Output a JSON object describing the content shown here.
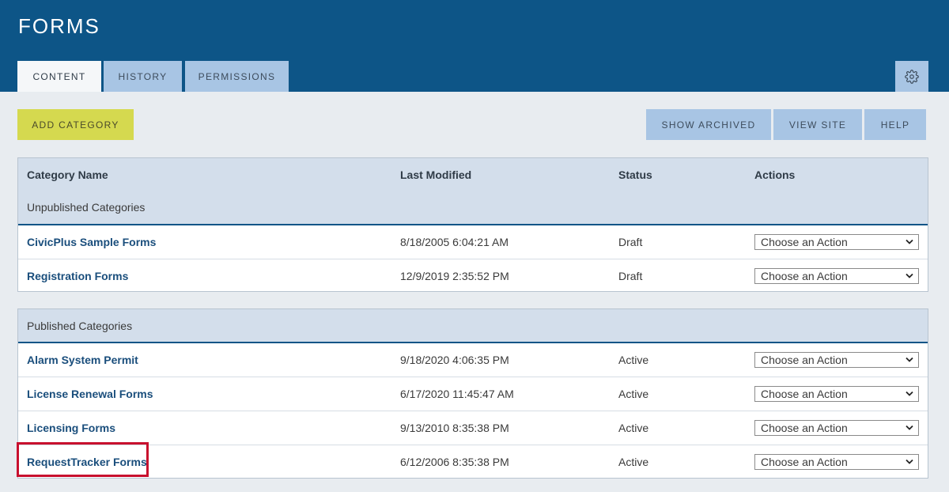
{
  "header": {
    "title": "FORMS"
  },
  "tabs": [
    {
      "label": "CONTENT",
      "active": true
    },
    {
      "label": "HISTORY",
      "active": false
    },
    {
      "label": "PERMISSIONS",
      "active": false
    }
  ],
  "settings": {
    "icon": "gear-icon"
  },
  "toolbar": {
    "add_category": "ADD CATEGORY",
    "show_archived": "SHOW ARCHIVED",
    "view_site": "VIEW SITE",
    "help": "HELP"
  },
  "columns": {
    "name": "Category Name",
    "modified": "Last Modified",
    "status": "Status",
    "actions": "Actions"
  },
  "unpublished": {
    "label": "Unpublished Categories",
    "rows": [
      {
        "name": "CivicPlus Sample Forms",
        "modified": "8/18/2005 6:04:21 AM",
        "status": "Draft",
        "action": "Choose an Action"
      },
      {
        "name": "Registration Forms",
        "modified": "12/9/2019 2:35:52 PM",
        "status": "Draft",
        "action": "Choose an Action"
      }
    ]
  },
  "published": {
    "label": "Published Categories",
    "rows": [
      {
        "name": "Alarm System Permit",
        "modified": "9/18/2020 4:06:35 PM",
        "status": "Active",
        "action": "Choose an Action"
      },
      {
        "name": "License Renewal Forms",
        "modified": "6/17/2020 11:45:47 AM",
        "status": "Active",
        "action": "Choose an Action"
      },
      {
        "name": "Licensing Forms",
        "modified": "9/13/2010 8:35:38 PM",
        "status": "Active",
        "action": "Choose an Action"
      },
      {
        "name": "RequestTracker Forms",
        "modified": "6/12/2006 8:35:38 PM",
        "status": "Active",
        "action": "Choose an Action"
      }
    ]
  },
  "colors": {
    "header": "#0d5587",
    "tab": "#a8c5e4",
    "add_button": "#d5d94f",
    "link": "#1a4e7c",
    "highlight": "#c8102e"
  }
}
